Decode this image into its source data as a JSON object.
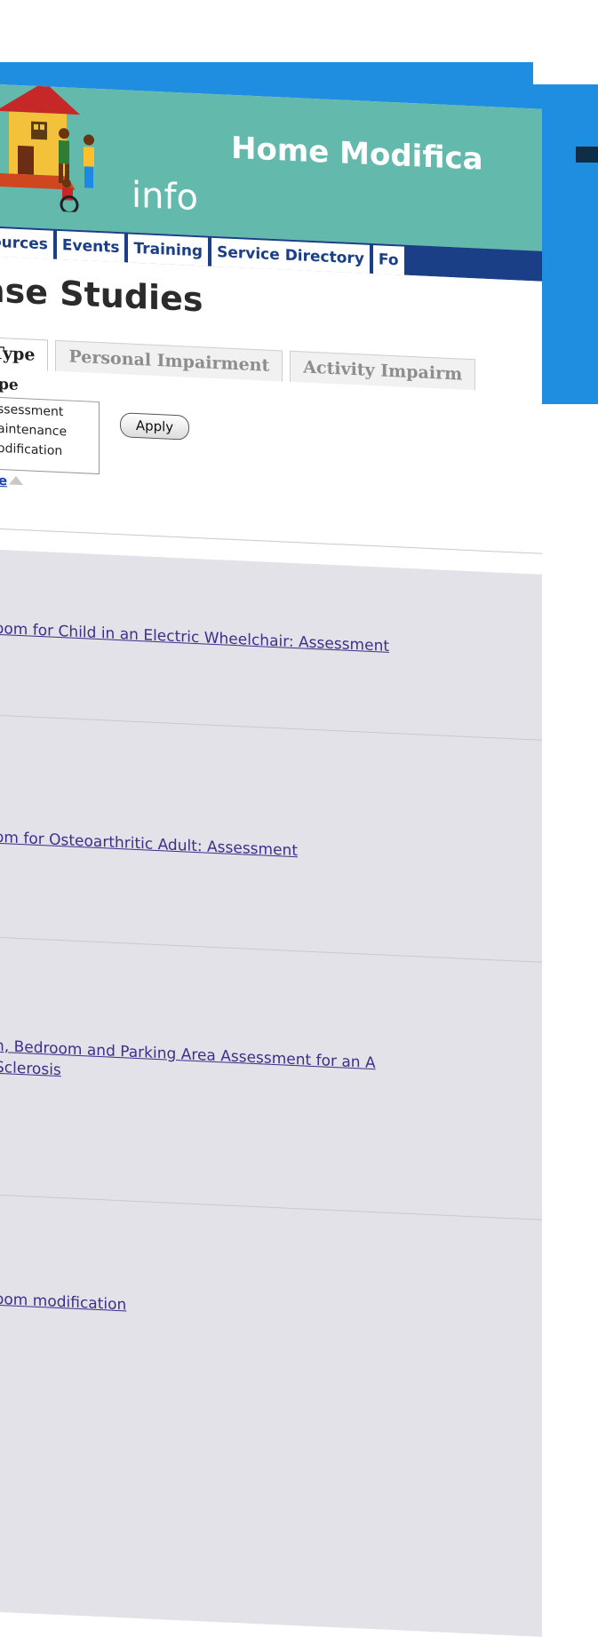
{
  "site": {
    "title": "Home Modifica",
    "subtitle": "info"
  },
  "nav": {
    "items": [
      "ources",
      "Events",
      "Training",
      "Service Directory",
      "Fo"
    ]
  },
  "page": {
    "title": "ase Studies"
  },
  "tabs": {
    "items": [
      "Type",
      "Personal Impairment",
      "Activity Impairm"
    ]
  },
  "filter": {
    "label": "pe",
    "options": [
      "ssessment",
      "aintenance",
      "odification"
    ],
    "apply_label": "Apply",
    "sort_label": "e"
  },
  "rows": [
    {
      "line1": "oom for Child in an Electric Wheelchair: Assessment",
      "line2": ""
    },
    {
      "line1": "om for Osteoarthritic Adult: Assessment",
      "line2": ""
    },
    {
      "line1": "n, Bedroom and Parking Area Assessment for an A",
      "line2": "Sclerosis"
    },
    {
      "line1": "oom modification",
      "line2": ""
    }
  ],
  "colors": {
    "background_blue": "#1f8de0",
    "header_teal": "#64b9ad",
    "nav_navy": "#1a3f86",
    "link_purple": "#3d2f8a"
  }
}
